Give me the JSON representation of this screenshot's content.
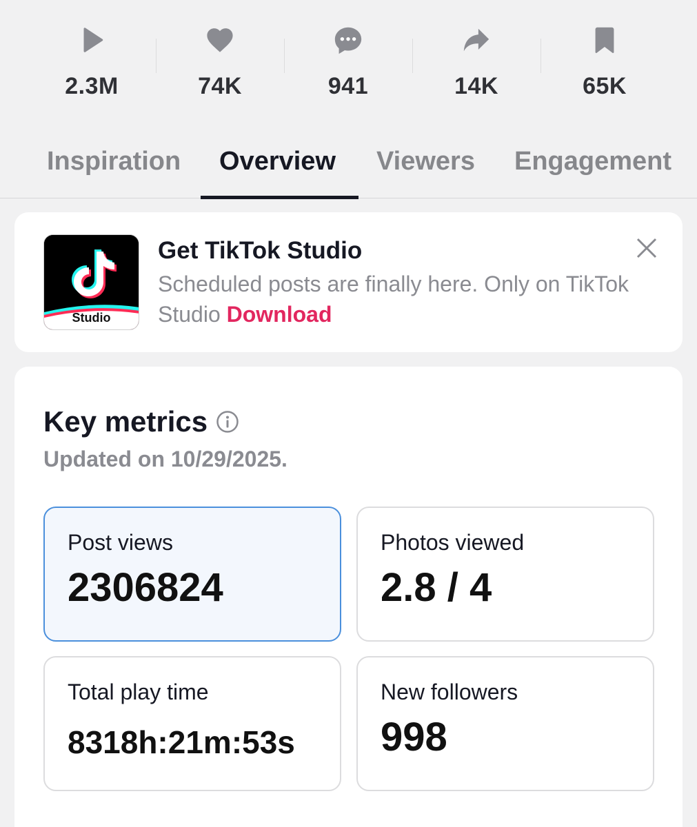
{
  "stats": [
    {
      "icon": "play-icon",
      "value": "2.3M"
    },
    {
      "icon": "heart-icon",
      "value": "74K"
    },
    {
      "icon": "comment-icon",
      "value": "941"
    },
    {
      "icon": "share-icon",
      "value": "14K"
    },
    {
      "icon": "bookmark-icon",
      "value": "65K"
    }
  ],
  "tabs": [
    {
      "label": "Inspiration",
      "active": false
    },
    {
      "label": "Overview",
      "active": true
    },
    {
      "label": "Viewers",
      "active": false
    },
    {
      "label": "Engagement",
      "active": false
    }
  ],
  "promo": {
    "icon_label": "Studio",
    "title": "Get TikTok Studio",
    "text": "Scheduled posts are finally here. Only on TikTok Studio",
    "link": "Download",
    "close_icon": "close-icon"
  },
  "key_metrics": {
    "title": "Key metrics",
    "updated": "Updated on 10/29/2025.",
    "tiles": [
      {
        "label": "Post views",
        "value": "2306824",
        "selected": true
      },
      {
        "label": "Photos viewed",
        "value": "2.8 / 4",
        "selected": false
      },
      {
        "label": "Total play time",
        "value": "8318h:21m:53s",
        "selected": false
      },
      {
        "label": "New followers",
        "value": "998",
        "selected": false
      }
    ]
  },
  "colors": {
    "background": "#f1f1f2",
    "accent_pink": "#e2275f",
    "selected_border": "#4a8fdc",
    "selected_fill": "#f3f7fd",
    "muted_text": "#8a8b91"
  }
}
